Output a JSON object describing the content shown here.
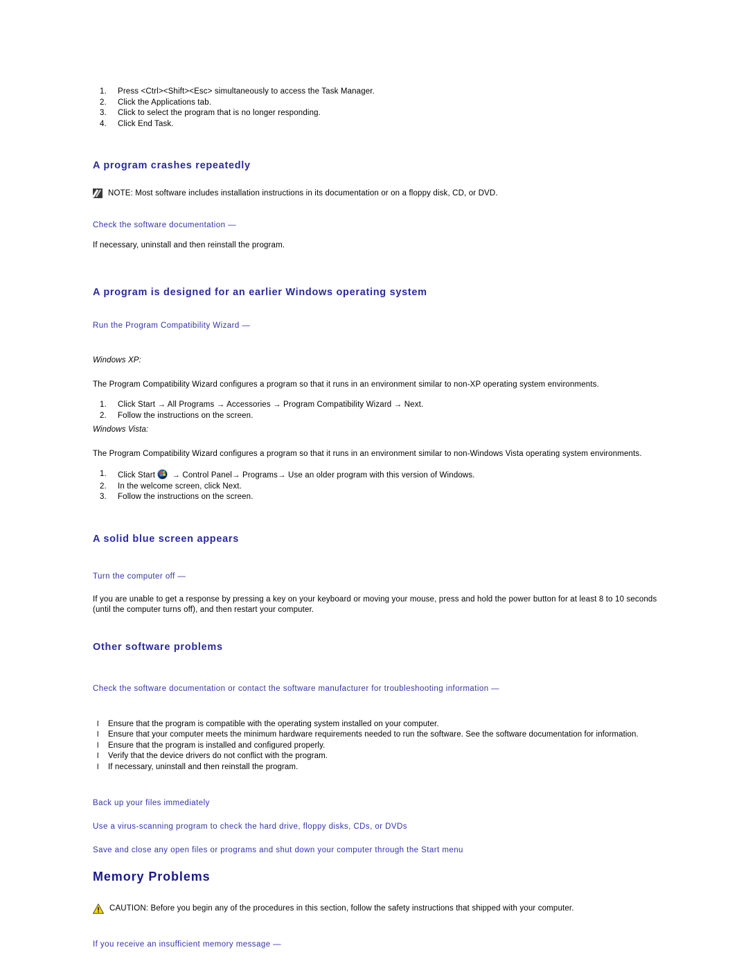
{
  "intro_steps": {
    "items": [
      "Press <Ctrl><Shift><Esc> simultaneously to access the Task Manager.",
      "Click the Applications tab.",
      "Click to select the program that is no longer responding.",
      "Click End Task."
    ]
  },
  "section_crashes": {
    "heading": "A program crashes repeatedly",
    "note": {
      "icon": "note-pencil-icon",
      "label": "NOTE:",
      "text": " Most software includes installation instructions in its documentation or on a floppy disk, CD, or DVD."
    },
    "lead": "Check the software documentation —",
    "body": "If necessary, uninstall and then reinstall the program."
  },
  "section_earlier_windows": {
    "heading": "A program is designed for an earlier Windows operating system",
    "lead": "Run the Program Compatibility Wizard —",
    "xp": {
      "label": "Windows XP:",
      "body": "The Program Compatibility Wizard configures a program so that it runs in an environment similar to non-XP operating system environments.",
      "steps": [
        "Click Start → All Programs → Accessories → Program Compatibility Wizard → Next.",
        "Follow the instructions on the screen."
      ]
    },
    "vista": {
      "label": "Windows Vista:",
      "body": "The Program Compatibility Wizard configures a program so that it runs in an environment similar to non-Windows Vista operating system environments.",
      "step1_before_orb": "Click Start",
      "orb_icon": "windows-vista-start-orb-icon",
      "step1_after_orb": " → Control Panel→ Programs→ Use an older program with this version of Windows.",
      "step2": "In the welcome screen, click Next.",
      "step3": "Follow the instructions on the screen."
    }
  },
  "section_blue_screen": {
    "heading": "A solid blue screen appears",
    "lead": "Turn the computer off —",
    "body_line1": "If you are unable to get a response by pressing a key on your keyboard or moving your mouse, press and hold the power button for at least 8 to 10 seconds",
    "body_line2": "(until the computer turns off), and then restart your computer."
  },
  "section_other_software": {
    "heading": "Other software problems",
    "lead": "Check the software documentation or contact the software manufacturer for troubleshooting information —",
    "bullets": [
      "Ensure that the program is compatible with the operating system installed on your computer.",
      "Ensure that your computer meets the minimum hardware requirements needed to run the software. See the software documentation for information.",
      "Ensure that the program is installed and configured properly.",
      "Verify that the device drivers do not conflict with the program.",
      "If necessary, uninstall and then reinstall the program."
    ],
    "extra_leads": [
      "Back up your files immediately",
      "Use a virus-scanning program to check the hard drive, floppy disks, CDs, or DVDs",
      "Save and close any open files or programs and shut down your computer through the Start menu"
    ]
  },
  "section_memory": {
    "heading": "Memory Problems",
    "caution": {
      "icon": "caution-warning-triangle-icon",
      "label": "CAUTION:",
      "text": " Before you begin any of the procedures in this section, follow the safety instructions that shipped with your computer."
    },
    "lead": "If you receive an insufficient memory message —"
  },
  "colors": {
    "heading_navy": "#1a1a8c",
    "subheading_blue": "#2a2a9e",
    "lead_blue": "#3333aa",
    "body_black": "#000000",
    "caution_yellow": "#f5d800",
    "note_icon_dark": "#3a3a3a"
  }
}
